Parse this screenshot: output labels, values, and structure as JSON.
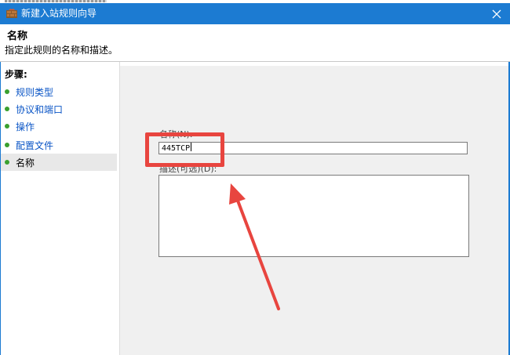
{
  "window": {
    "title": "新建入站规则向导"
  },
  "header": {
    "title": "名称",
    "description": "指定此规则的名称和描述。"
  },
  "sidebar": {
    "heading": "步骤:",
    "steps": [
      {
        "label": "规则类型"
      },
      {
        "label": "协议和端口"
      },
      {
        "label": "操作"
      },
      {
        "label": "配置文件"
      },
      {
        "label": "名称"
      }
    ],
    "current_step": "名称"
  },
  "form": {
    "name_label": "名称(N):",
    "name_value": "445TCP",
    "description_label": "描述(可选)(D):",
    "description_value": ""
  },
  "colors": {
    "titlebar": "#1c7bd2",
    "annotation": "#e8453f",
    "step_dot": "#3aa02e",
    "step_link": "#0a55c6"
  },
  "icons": {
    "app": "firewall-icon",
    "close": "close-icon",
    "step": "step-dot-icon"
  }
}
